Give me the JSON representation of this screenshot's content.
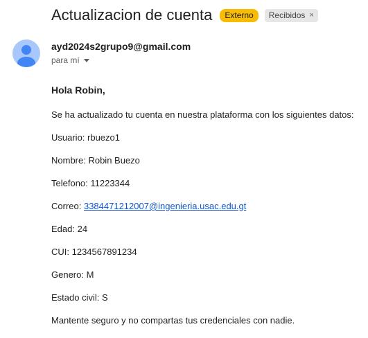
{
  "subject": "Actualizacion de cuenta",
  "labels": {
    "external": "Externo",
    "inbox": "Recibidos",
    "inbox_close": "×"
  },
  "sender": {
    "email": "ayd2024s2grupo9@gmail.com",
    "to": "para mí"
  },
  "message": {
    "greeting": "Hola Robin,",
    "intro": "Se ha actualizado tu cuenta en nuestra plataforma con los siguientes datos:",
    "usuario": "Usuario: rbuezo1",
    "nombre": "Nombre: Robin Buezo",
    "telefono": "Telefono: 11223344",
    "correo_label": "Correo: ",
    "correo_link": "3384471212007@ingenieria.usac.edu.gt",
    "edad": "Edad: 24",
    "cui": "CUI: 1234567891234",
    "genero": "Genero: M",
    "estado_civil": "Estado civil: S",
    "closing": "Mantente seguro y no compartas tus credenciales con nadie."
  },
  "colors": {
    "external_badge": "#f9bc04",
    "avatar_bg": "#a8c7fa",
    "avatar_fg": "#4285f4",
    "link": "#1155cc"
  }
}
